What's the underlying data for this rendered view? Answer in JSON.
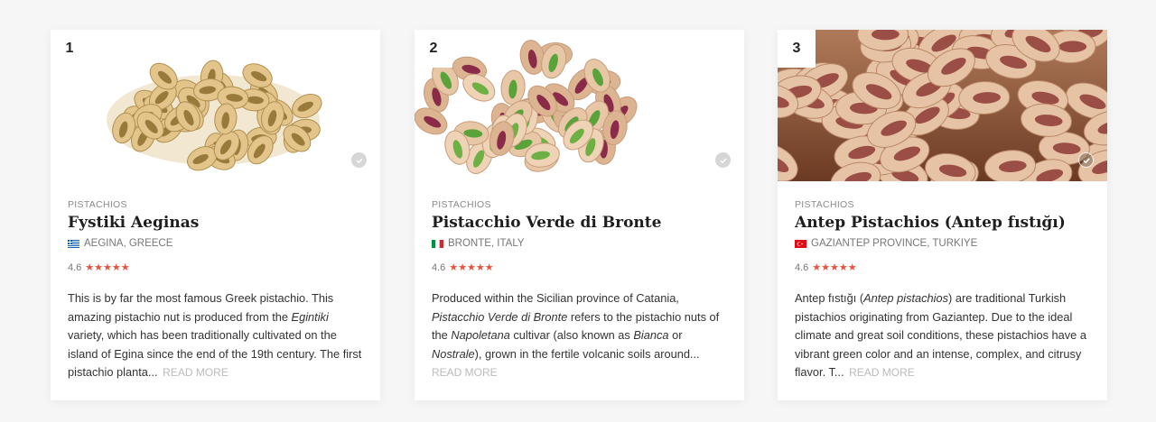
{
  "cards": [
    {
      "rank": "1",
      "category": "PISTACHIOS",
      "title": "Fystiki Aeginas",
      "origin": "AEGINA, GREECE",
      "rating": "4.6",
      "stars": "★★★★★",
      "desc": [
        "This is by far the most famous Greek pistachio. This amazing pistachio nut is produced from the ",
        "Egintiki",
        " variety, which has been traditionally cultivated on the island of Egina since the end of the 19th century. The first pistachio planta..."
      ],
      "read_more": "READ MORE",
      "image_icon": "pistachio-pile-image"
    },
    {
      "rank": "2",
      "category": "PISTACHIOS",
      "title": "Pistacchio Verde di Bronte",
      "origin": "BRONTE, ITALY",
      "rating": "4.6",
      "stars": "★★★★★",
      "desc": [
        "Produced within the Sicilian province of Catania, ",
        "Pistacchio Verde di Bronte",
        " refers to the pistachio nuts of the ",
        "Napoletana",
        " cultivar (also known as ",
        "Bianca",
        " or ",
        "Nostrale",
        "), grown in the fertile volcanic soils around..."
      ],
      "read_more": "READ MORE",
      "image_icon": "pistachio-mixed-image"
    },
    {
      "rank": "3",
      "category": "PISTACHIOS",
      "title": "Antep Pistachios (Antep fıstığı)",
      "origin": "GAZIANTEP PROVINCE, TURKIYE",
      "rating": "4.6",
      "stars": "★★★★★",
      "desc": [
        "Antep fıstığı (",
        "Antep pistachios",
        ") are traditional Turkish pistachios originating from Gaziantep. Due to the ideal climate and great soil conditions, these pistachios have a vibrant green color and an intense, complex, and citrusy flavor. T..."
      ],
      "read_more": "READ MORE",
      "image_icon": "pistachio-closeup-image"
    }
  ],
  "colors": {
    "star": "#e5533d",
    "background": "#f6f6f6",
    "card": "#ffffff",
    "muted": "#8a8a8a"
  }
}
